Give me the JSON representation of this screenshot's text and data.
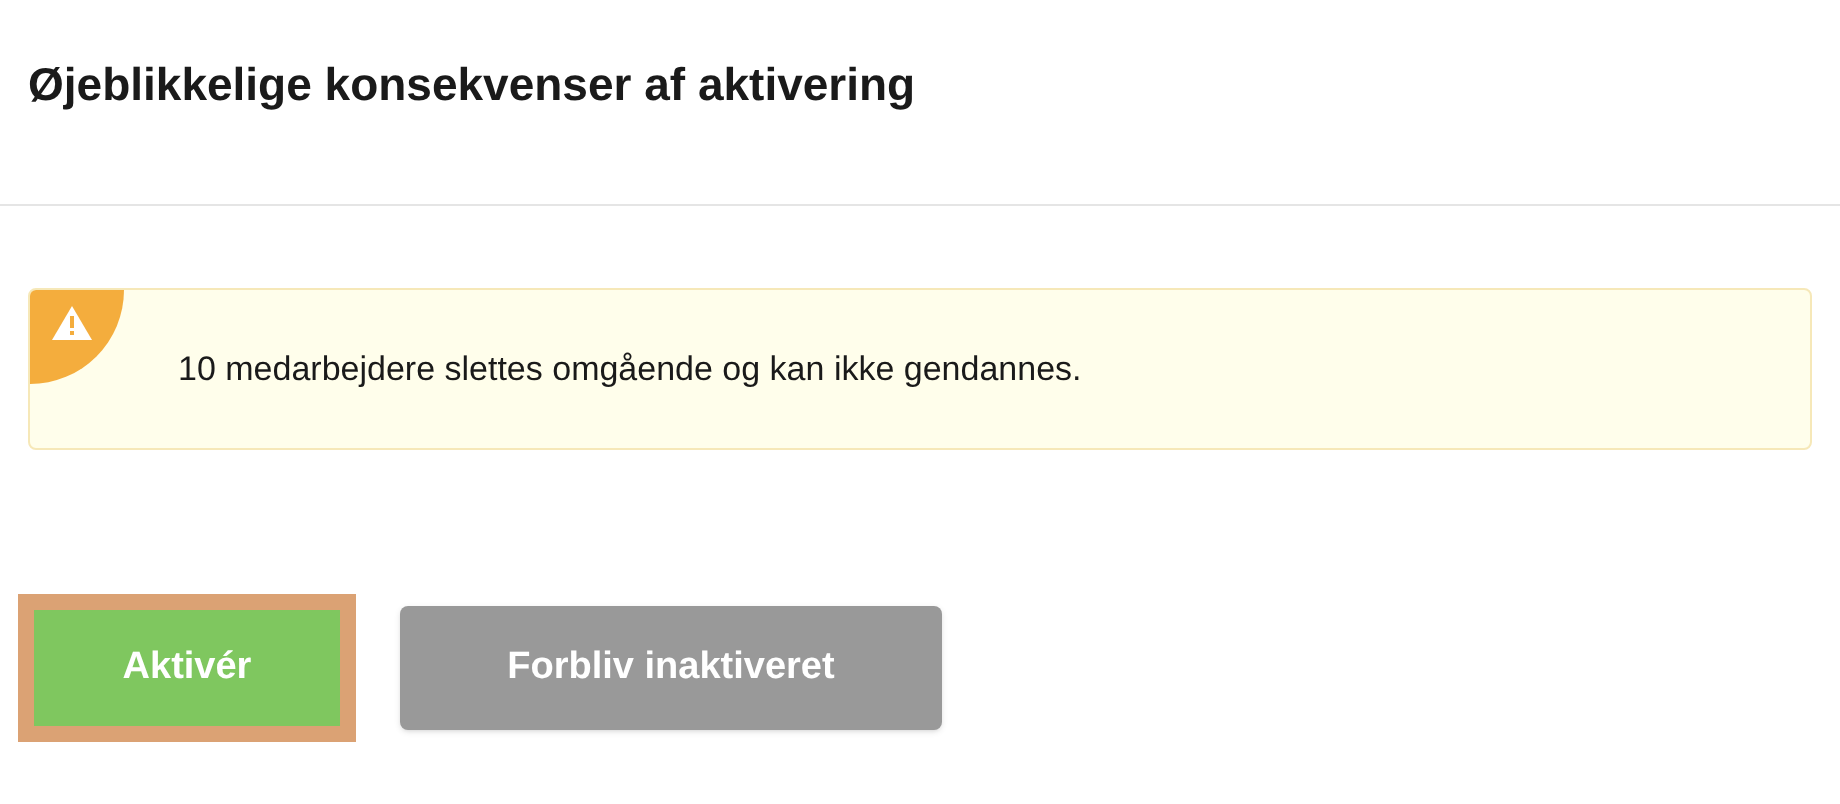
{
  "dialog": {
    "title": "Øjeblikkelige konsekvenser af aktivering"
  },
  "warning": {
    "message": "10 medarbejdere slettes omgående og kan ikke gendannes."
  },
  "buttons": [
    {
      "kind": "primary",
      "label": "Aktivér",
      "focused": true
    },
    {
      "kind": "secondary",
      "label": "Forbliv inaktiveret",
      "focused": false
    }
  ]
}
